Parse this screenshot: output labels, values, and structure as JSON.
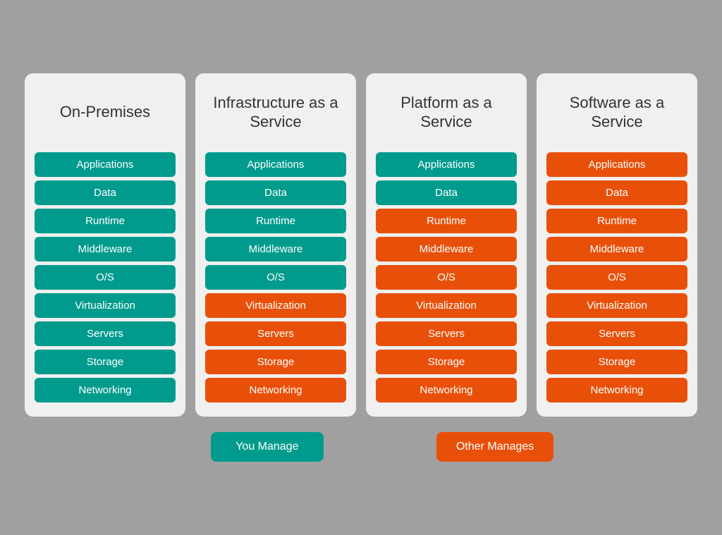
{
  "columns": [
    {
      "id": "on-premises",
      "title": "On-Premises",
      "items": [
        {
          "label": "Applications",
          "color": "teal"
        },
        {
          "label": "Data",
          "color": "teal"
        },
        {
          "label": "Runtime",
          "color": "teal"
        },
        {
          "label": "Middleware",
          "color": "teal"
        },
        {
          "label": "O/S",
          "color": "teal"
        },
        {
          "label": "Virtualization",
          "color": "teal"
        },
        {
          "label": "Servers",
          "color": "teal"
        },
        {
          "label": "Storage",
          "color": "teal"
        },
        {
          "label": "Networking",
          "color": "teal"
        }
      ]
    },
    {
      "id": "iaas",
      "title": "Infrastructure as a Service",
      "items": [
        {
          "label": "Applications",
          "color": "teal"
        },
        {
          "label": "Data",
          "color": "teal"
        },
        {
          "label": "Runtime",
          "color": "teal"
        },
        {
          "label": "Middleware",
          "color": "teal"
        },
        {
          "label": "O/S",
          "color": "teal"
        },
        {
          "label": "Virtualization",
          "color": "orange"
        },
        {
          "label": "Servers",
          "color": "orange"
        },
        {
          "label": "Storage",
          "color": "orange"
        },
        {
          "label": "Networking",
          "color": "orange"
        }
      ]
    },
    {
      "id": "paas",
      "title": "Platform as a Service",
      "items": [
        {
          "label": "Applications",
          "color": "teal"
        },
        {
          "label": "Data",
          "color": "teal"
        },
        {
          "label": "Runtime",
          "color": "orange"
        },
        {
          "label": "Middleware",
          "color": "orange"
        },
        {
          "label": "O/S",
          "color": "orange"
        },
        {
          "label": "Virtualization",
          "color": "orange"
        },
        {
          "label": "Servers",
          "color": "orange"
        },
        {
          "label": "Storage",
          "color": "orange"
        },
        {
          "label": "Networking",
          "color": "orange"
        }
      ]
    },
    {
      "id": "saas",
      "title": "Software as a Service",
      "items": [
        {
          "label": "Applications",
          "color": "orange"
        },
        {
          "label": "Data",
          "color": "orange"
        },
        {
          "label": "Runtime",
          "color": "orange"
        },
        {
          "label": "Middleware",
          "color": "orange"
        },
        {
          "label": "O/S",
          "color": "orange"
        },
        {
          "label": "Virtualization",
          "color": "orange"
        },
        {
          "label": "Servers",
          "color": "orange"
        },
        {
          "label": "Storage",
          "color": "orange"
        },
        {
          "label": "Networking",
          "color": "orange"
        }
      ]
    }
  ],
  "legend": {
    "you_manage": "You Manage",
    "other_manages": "Other Manages"
  }
}
